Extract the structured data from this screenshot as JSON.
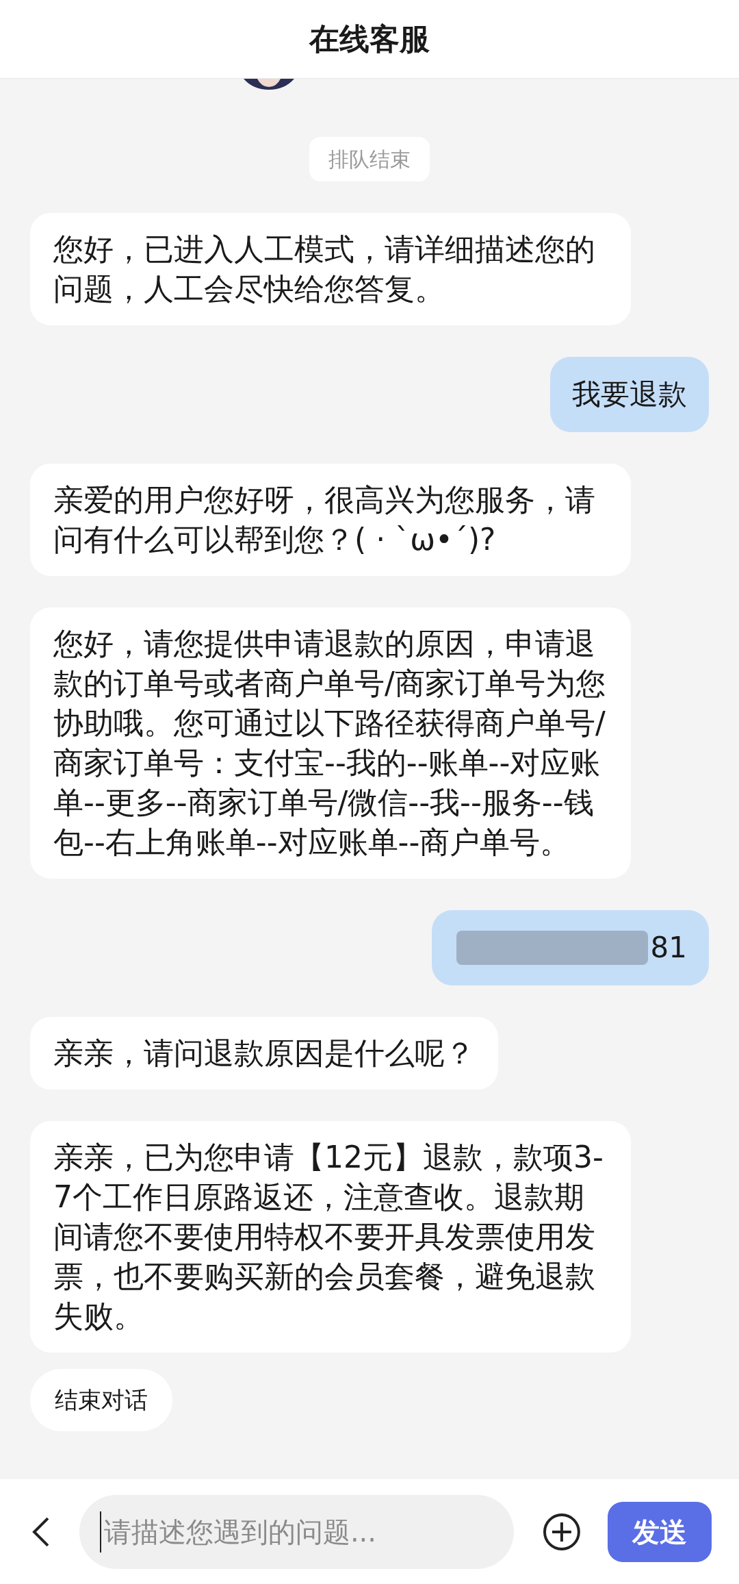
{
  "header": {
    "title": "在线客服"
  },
  "messages": [
    {
      "kind": "notice",
      "text": "排队结束"
    },
    {
      "kind": "agent",
      "text": "您好，已进入人工模式，请详细描述您的问题，人工会尽快给您答复。"
    },
    {
      "kind": "user",
      "text": "我要退款"
    },
    {
      "kind": "agent",
      "text": "亲爱的用户您好呀，很高兴为您服务，请问有什么可以帮到您？( · ˋω•´)?"
    },
    {
      "kind": "agent",
      "text": "您好，请您提供申请退款的原因，申请退款的订单号或者商户单号/商家订单号为您协助哦。您可通过以下路径获得商户单号/商家订单号：支付宝--我的--账单--对应账单--更多--商家订单号/微信--我--服务--钱包--右上角账单--对应账单--商户单号。"
    },
    {
      "kind": "user_redacted",
      "text": "81"
    },
    {
      "kind": "agent",
      "text": "亲亲，请问退款原因是什么呢？"
    },
    {
      "kind": "agent",
      "text": "亲亲，已为您申请【12元】退款，款项3-7个工作日原路返还，注意查收。退款期间请您不要使用特权不要开具发票使用发票，也不要购买新的会员套餐，避免退款失败。"
    },
    {
      "kind": "action",
      "text": "结束对话"
    }
  ],
  "input_bar": {
    "placeholder": "请描述您遇到的问题...",
    "send_label": "发送"
  }
}
